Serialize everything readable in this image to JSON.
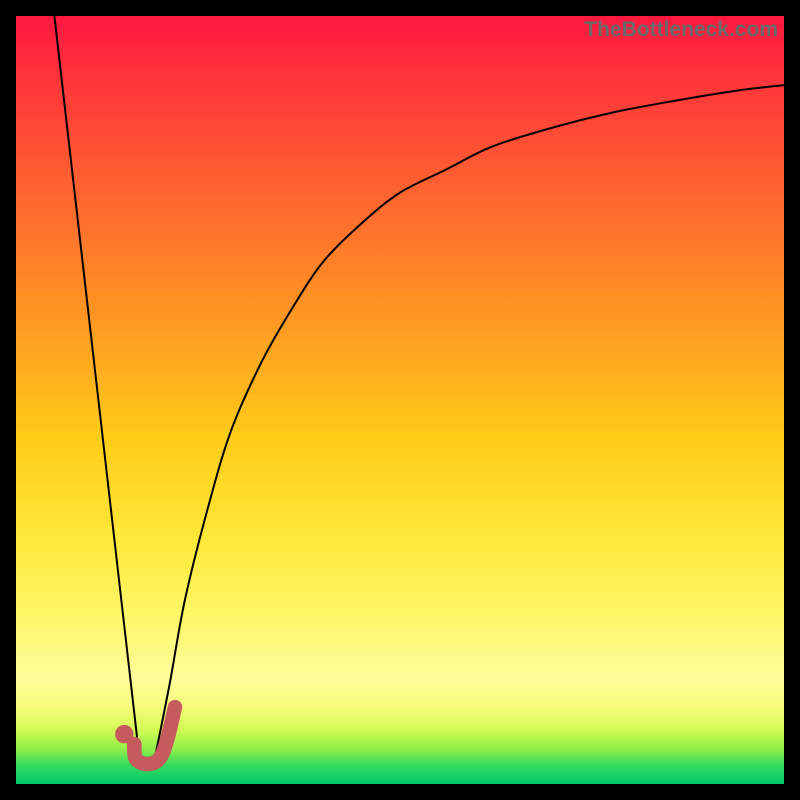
{
  "watermark": "TheBottleneck.com",
  "colors": {
    "frame": "#000000",
    "curve": "#000000",
    "marker_stroke": "#c65b5e",
    "marker_fill": "#c65b5e",
    "gradient_stops": [
      {
        "offset": 0.0,
        "color": "#ff183f"
      },
      {
        "offset": 0.1,
        "color": "#ff3a3a"
      },
      {
        "offset": 0.25,
        "color": "#ff6a2f"
      },
      {
        "offset": 0.4,
        "color": "#ff9a22"
      },
      {
        "offset": 0.55,
        "color": "#ffcc18"
      },
      {
        "offset": 0.68,
        "color": "#ffe83a"
      },
      {
        "offset": 0.78,
        "color": "#fff766"
      },
      {
        "offset": 0.86,
        "color": "#fffc9a"
      },
      {
        "offset": 0.9,
        "color": "#f5fd7a"
      },
      {
        "offset": 0.93,
        "color": "#d2fa55"
      },
      {
        "offset": 0.955,
        "color": "#90ee4a"
      },
      {
        "offset": 0.975,
        "color": "#36dc5e"
      },
      {
        "offset": 1.0,
        "color": "#00c86b"
      }
    ]
  },
  "chart_data": {
    "type": "line",
    "title": "",
    "xlabel": "",
    "ylabel": "",
    "xlim": [
      0,
      100
    ],
    "ylim": [
      0,
      100
    ],
    "grid": false,
    "legend": false,
    "series": [
      {
        "name": "left-falling-line",
        "x": [
          5,
          16
        ],
        "y": [
          100,
          4
        ]
      },
      {
        "name": "right-rising-curve",
        "x": [
          18,
          20,
          22,
          25,
          28,
          32,
          36,
          40,
          45,
          50,
          56,
          62,
          70,
          78,
          86,
          94,
          100
        ],
        "y": [
          3,
          13,
          24,
          36,
          46,
          55,
          62,
          68,
          73,
          77,
          80,
          83,
          85.5,
          87.5,
          89,
          90.3,
          91
        ]
      }
    ],
    "marker": {
      "name": "j-marker",
      "dot": {
        "x": 14.1,
        "y": 6.5,
        "r": 1.2
      },
      "hook_path": [
        {
          "x": 15.4,
          "y": 5.2
        },
        {
          "x": 15.6,
          "y": 3.3
        },
        {
          "x": 17.0,
          "y": 2.6
        },
        {
          "x": 18.6,
          "y": 3.2
        },
        {
          "x": 19.6,
          "y": 5.5
        },
        {
          "x": 20.7,
          "y": 10.0
        }
      ]
    }
  }
}
